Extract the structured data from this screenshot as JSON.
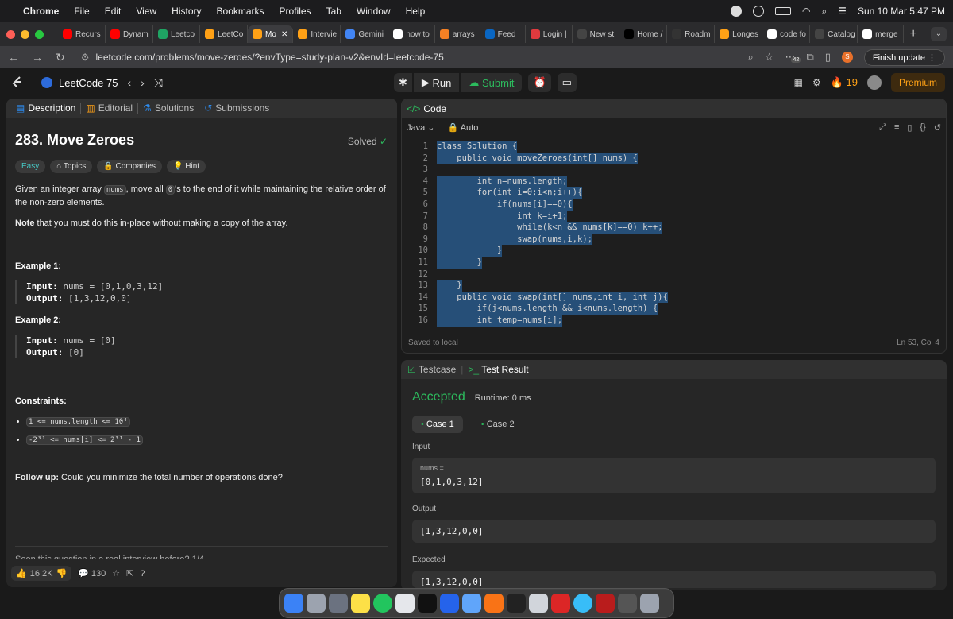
{
  "menubar": {
    "apple": "",
    "app": "Chrome",
    "items": [
      "File",
      "Edit",
      "View",
      "History",
      "Bookmarks",
      "Profiles",
      "Tab",
      "Window",
      "Help"
    ],
    "clock": "Sun 10 Mar  5:47 PM"
  },
  "tabs": [
    {
      "label": "Recurs",
      "color": "#ff0000"
    },
    {
      "label": "Dynam",
      "color": "#ff0000"
    },
    {
      "label": "Leetco",
      "color": "#1fa463"
    },
    {
      "label": "LeetCo",
      "color": "#ffa116"
    },
    {
      "label": "Mo",
      "color": "#ffa116",
      "active": true
    },
    {
      "label": "Intervie",
      "color": "#ffa116"
    },
    {
      "label": "Gemini",
      "color": "#4285f4"
    },
    {
      "label": "how to",
      "color": "#ffffff"
    },
    {
      "label": "arrays",
      "color": "#f48024"
    },
    {
      "label": "Feed |",
      "color": "#0a66c2"
    },
    {
      "label": "Login |",
      "color": "#e03a3e"
    },
    {
      "label": "New st",
      "color": "#444444"
    },
    {
      "label": "Home /",
      "color": "#000000"
    },
    {
      "label": "Roadm",
      "color": "#333333"
    },
    {
      "label": "Longes",
      "color": "#ffa116"
    },
    {
      "label": "code fo",
      "color": "#ffffff"
    },
    {
      "label": "Catalog",
      "color": "#444444"
    },
    {
      "label": "merge",
      "color": "#ffffff"
    }
  ],
  "address": {
    "url": "leetcode.com/problems/move-zeroes/?envType=study-plan-v2&envId=leetcode-75",
    "update": "Finish update",
    "badge": "42",
    "profile": "S"
  },
  "lc": {
    "list_title": "LeetCode 75",
    "run": "Run",
    "submit": "Submit",
    "streak": "19",
    "premium": "Premium"
  },
  "left_tabs": [
    "Description",
    "Editorial",
    "Solutions",
    "Submissions"
  ],
  "problem": {
    "title": "283. Move Zeroes",
    "status": "Solved",
    "chips": [
      "Easy",
      "Topics",
      "Companies",
      "Hint"
    ],
    "text1a": "Given an integer array ",
    "text1code": "nums",
    "text1b": ", move all ",
    "text1code2": "0",
    "text1c": "'s to the end of it while maintaining the relative order of the non-zero elements.",
    "note_bold": "Note",
    "note_rest": " that you must do this in-place without making a copy of the array.",
    "ex1_title": "Example 1:",
    "ex1_input_label": "Input:",
    "ex1_input": "nums = [0,1,0,3,12]",
    "ex1_output_label": "Output:",
    "ex1_output": "[1,3,12,0,0]",
    "ex2_title": "Example 2:",
    "ex2_input_label": "Input:",
    "ex2_input": "nums = [0]",
    "ex2_output_label": "Output:",
    "ex2_output": "[0]",
    "constraints_title": "Constraints:",
    "c1": "1 <= nums.length <= 10⁴",
    "c2": "-2³¹ <= nums[i] <= 2³¹ - 1",
    "followup_bold": "Follow up:",
    "followup_rest": " Could you minimize the total number of operations done?",
    "cut_text": "Seen this question in a real interview before?   1/4"
  },
  "footer": {
    "likes": "16.2K",
    "comments": "130"
  },
  "code": {
    "header": "Code",
    "lang": "Java",
    "auto": "Auto",
    "saved": "Saved to local",
    "pos": "Ln 53, Col 4",
    "lines": [
      "class Solution {",
      "    public void moveZeroes(int[] nums) {",
      "",
      "        int n=nums.length;",
      "        for(int i=0;i<n;i++){",
      "            if(nums[i]==0){",
      "                int k=i+1;",
      "                while(k<n && nums[k]==0) k++;",
      "                swap(nums,i,k);",
      "            }",
      "        }",
      "",
      "    }",
      "    public void swap(int[] nums,int i, int j){",
      "        if(j<nums.length && i<nums.length) {",
      "        int temp=nums[i];"
    ]
  },
  "result": {
    "tab1": "Testcase",
    "tab2": "Test Result",
    "status": "Accepted",
    "runtime": "Runtime: 0 ms",
    "case1": "Case 1",
    "case2": "Case 2",
    "input_label": "Input",
    "input_var": "nums =",
    "input_val": "[0,1,0,3,12]",
    "output_label": "Output",
    "output_val": "[1,3,12,0,0]",
    "expected_label": "Expected",
    "expected_val": "[1,3,12,0,0]"
  },
  "colors": {
    "accepted": "#2cbb5d",
    "premium": "#ffa116",
    "easy": "#46c6c2",
    "selection": "#264f78"
  }
}
